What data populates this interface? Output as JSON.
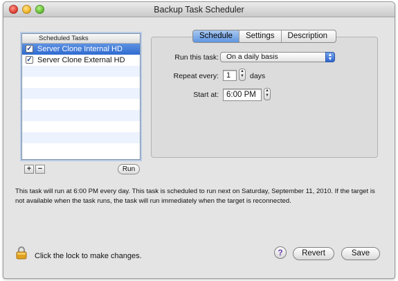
{
  "window": {
    "title": "Backup Task Scheduler"
  },
  "task_list": {
    "header": "Scheduled Tasks",
    "items": [
      {
        "label": "Server Clone Internal HD",
        "checked": true,
        "selected": true
      },
      {
        "label": "Server Clone External HD",
        "checked": true,
        "selected": false
      }
    ],
    "add_label": "+",
    "remove_label": "−",
    "run_label": "Run"
  },
  "tabs": [
    {
      "label": "Schedule",
      "active": true
    },
    {
      "label": "Settings",
      "active": false
    },
    {
      "label": "Description",
      "active": false
    }
  ],
  "schedule": {
    "run_label": "Run this task:",
    "run_value": "On a daily basis",
    "repeat_label": "Repeat every:",
    "repeat_value": "1",
    "repeat_unit": "days",
    "start_label": "Start at:",
    "start_value": "6:00 PM"
  },
  "info_text": "This task will run at 6:00 PM every day. This task is scheduled to run next on Saturday, September 11, 2010. If the target is not available when the task runs, the task will run immediately when the target is reconnected.",
  "footer": {
    "lock_text": "Click the lock to make changes.",
    "help_label": "?",
    "revert_label": "Revert",
    "save_label": "Save"
  },
  "colors": {
    "selection": "#2f6ad0",
    "window_bg": "#e4e4e4"
  }
}
